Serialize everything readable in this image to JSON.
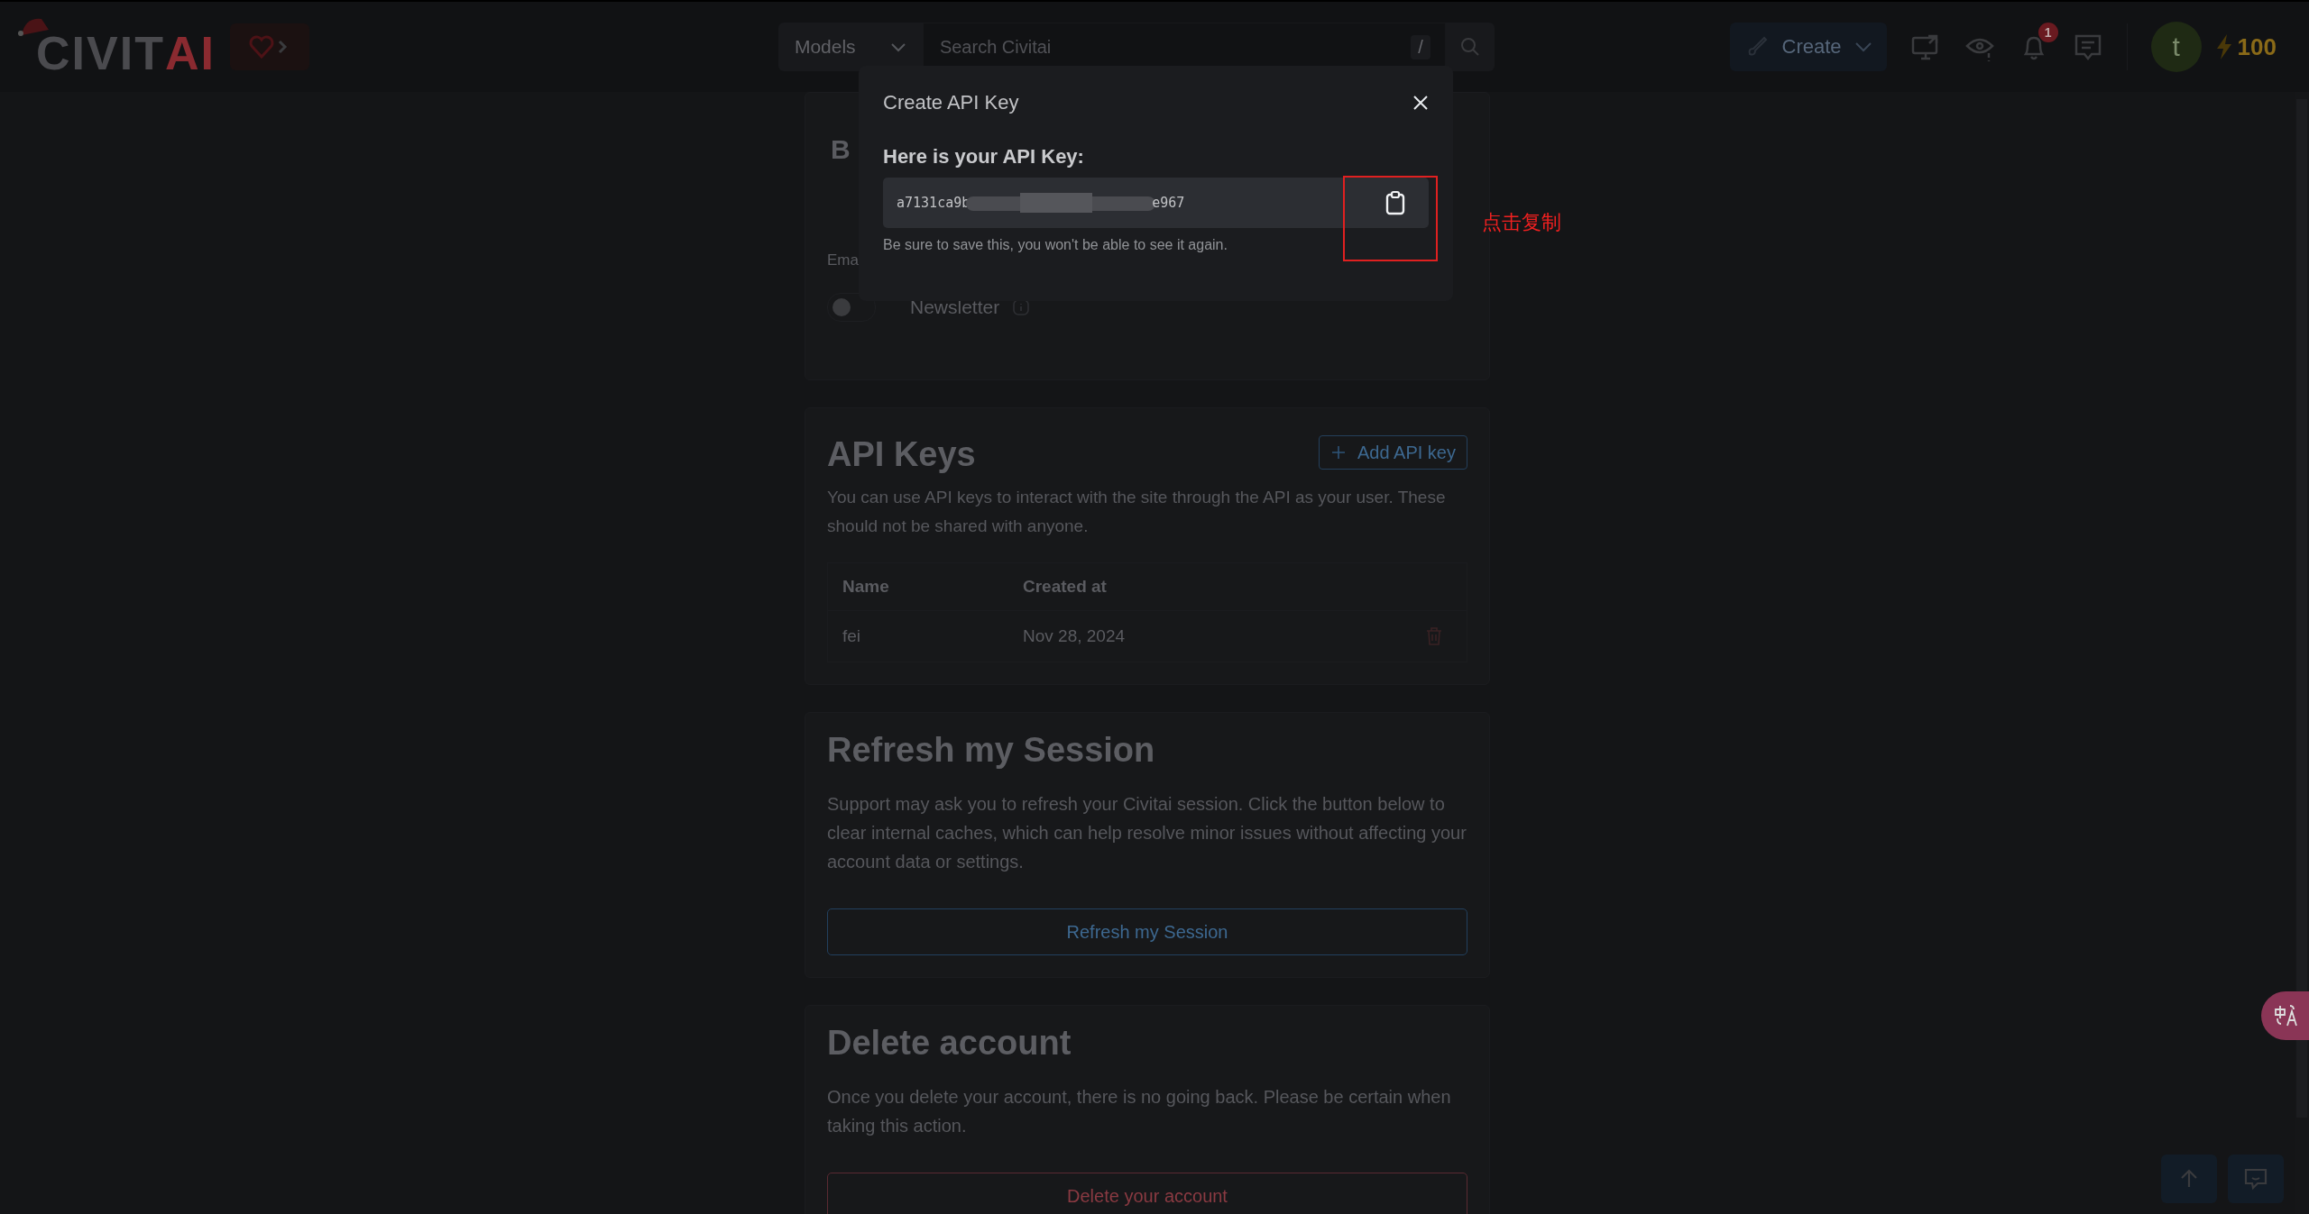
{
  "header": {
    "logo_main": "CIVIT",
    "logo_accent": "AI",
    "search": {
      "category": "Models",
      "placeholder": "Search Civitai",
      "shortcut": "/"
    },
    "create_button": "Create",
    "notification_count": "1",
    "avatar_initial": "t",
    "buzz": "100"
  },
  "email_card": {
    "heading": "B",
    "label": "Ema",
    "toggles": [
      {
        "label": "Newsletter",
        "on": false
      }
    ]
  },
  "api_keys": {
    "heading": "API Keys",
    "add_button": "Add API key",
    "description": "You can use API keys to interact with the site through the API as your user. These should not be shared with anyone.",
    "columns": [
      "Name",
      "Created at"
    ],
    "rows": [
      {
        "name": "fei",
        "created": "Nov 28, 2024"
      }
    ]
  },
  "refresh": {
    "heading": "Refresh my Session",
    "description": "Support may ask you to refresh your Civitai session. Click the button below to clear internal caches, which can help resolve minor issues without affecting your account data or settings.",
    "button": "Refresh my Session"
  },
  "delete": {
    "heading": "Delete account",
    "description": "Once you delete your account, there is no going back. Please be certain when taking this action.",
    "button": "Delete your account"
  },
  "modal": {
    "title": "Create API Key",
    "label": "Here is your API Key:",
    "key_start": "a7131ca9b",
    "key_end": "e967",
    "note": "Be sure to save this, you won't be able to see it again."
  },
  "annotation": {
    "text": "点击复制"
  }
}
